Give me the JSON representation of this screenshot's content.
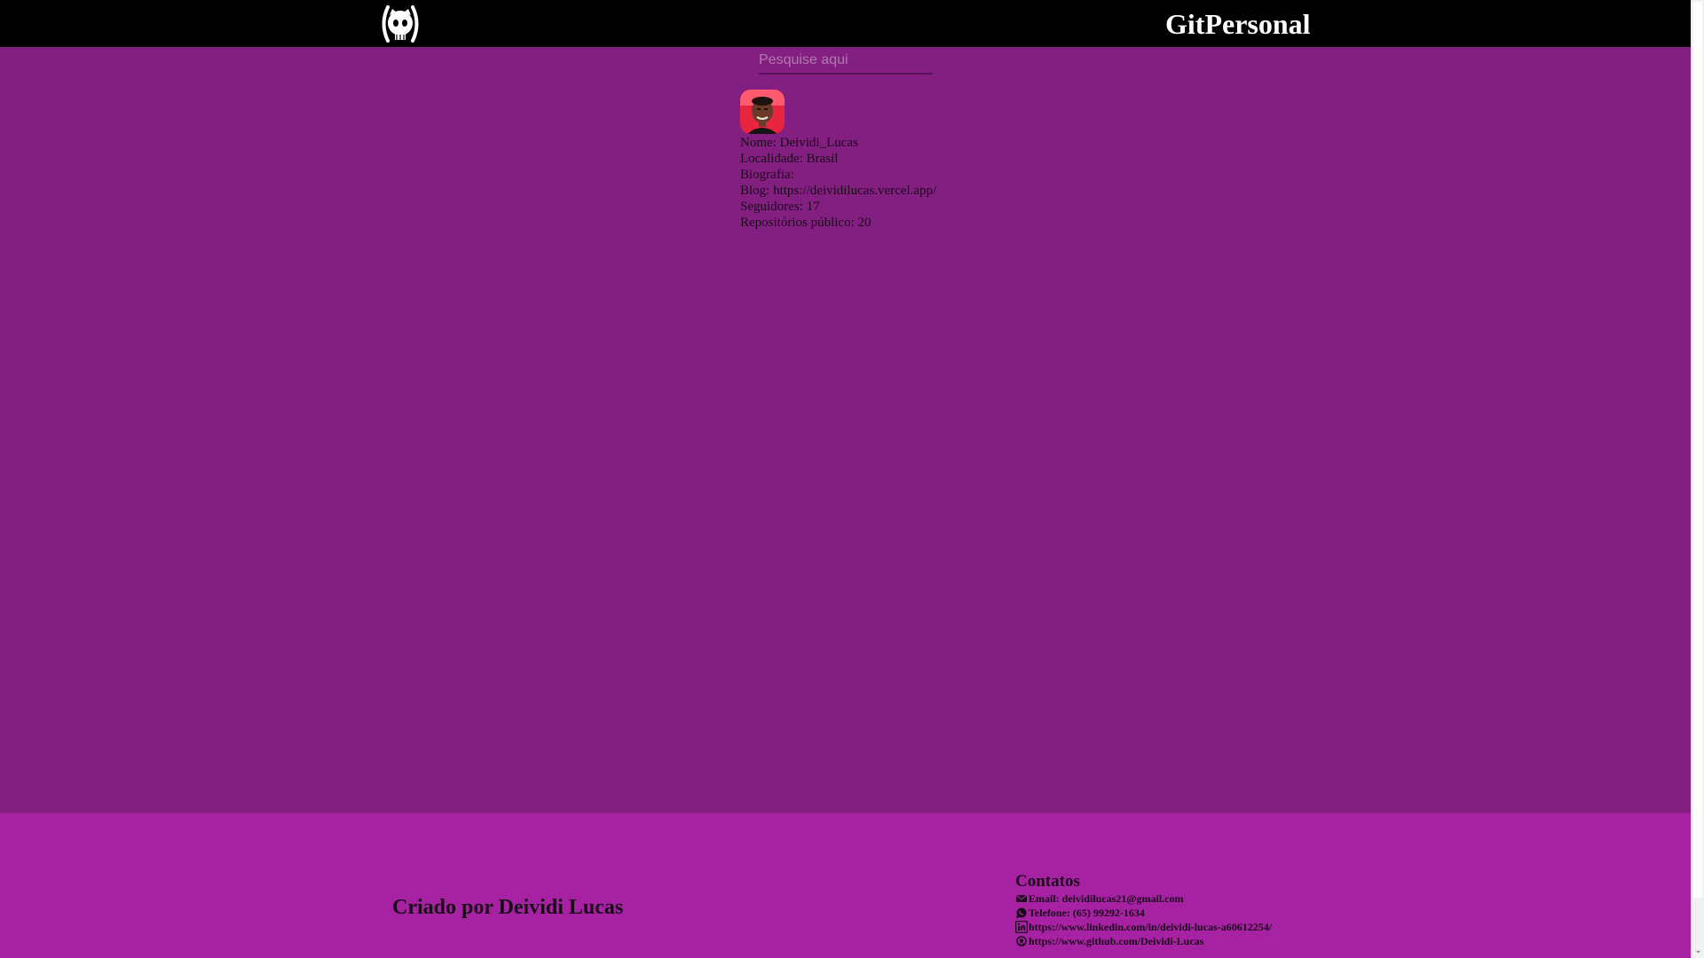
{
  "header": {
    "logo_icon": "github-octocat-icon",
    "brand": "GitPersonal"
  },
  "search": {
    "placeholder": "Pesquise aqui",
    "value": ""
  },
  "profile": {
    "avatar_icon": "user-avatar",
    "nome": "Nome: Deividi_Lucas",
    "localidade": "Localidade: Brasil",
    "biografia": "Biografia:",
    "blog": "Blog: https://deividilucas.vercel.app/",
    "seguidores": "Seguidores: 17",
    "repositorios": "Repositórios público: 20"
  },
  "footer": {
    "credit": "Criado por Deividi Lucas",
    "contacts_title": "Contatos",
    "contacts": [
      {
        "icon": "envelope-icon",
        "text": "Email: deividilucas21@gmail.com"
      },
      {
        "icon": "whatsapp-icon",
        "text": "Telefone: (65) 99292-1634"
      },
      {
        "icon": "linkedin-icon",
        "text": "https://www.linkedin.com/in/deividi-lucas-a60612254/"
      },
      {
        "icon": "github-icon",
        "text": "https://www.github.com/Deividi-Lucas"
      }
    ]
  },
  "colors": {
    "header_bg": "#000000",
    "page_bg": "#841f82",
    "footer_bg": "#a722a3",
    "text_dark": "#1a0a19",
    "brand_text": "#ffffff"
  }
}
